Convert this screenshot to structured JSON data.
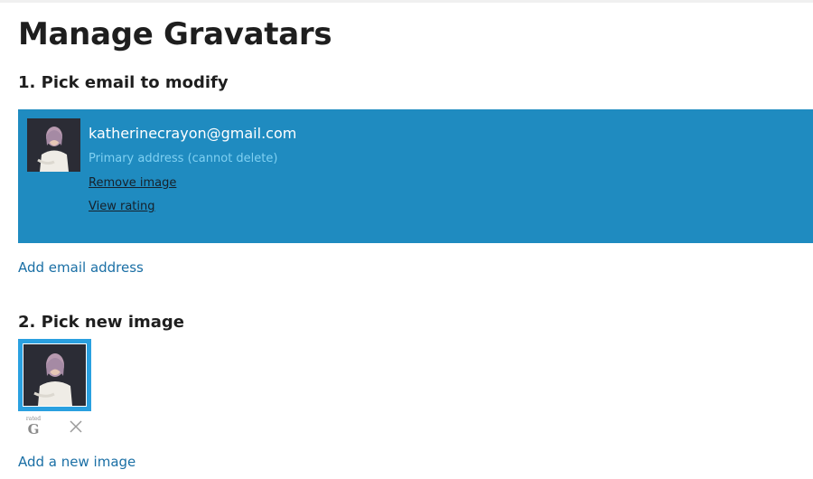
{
  "page": {
    "title": "Manage Gravatars"
  },
  "step1": {
    "heading": "1. Pick email to modify",
    "email": {
      "address": "katherinecrayon@gmail.com",
      "note": "Primary address (cannot delete)",
      "remove_label": "Remove image",
      "rating_label": "View rating",
      "avatar_icon": "avatar-photo"
    },
    "add_email_label": "Add email address"
  },
  "step2": {
    "heading": "2. Pick new image",
    "image": {
      "rating_word": "rated",
      "rating_letter": "G",
      "delete_icon": "close-x"
    },
    "add_image_label": "Add a new image"
  },
  "colors": {
    "panel_blue": "#1f8bc0",
    "link_blue": "#1a6fa5",
    "tile_border": "#2aa0e0"
  }
}
